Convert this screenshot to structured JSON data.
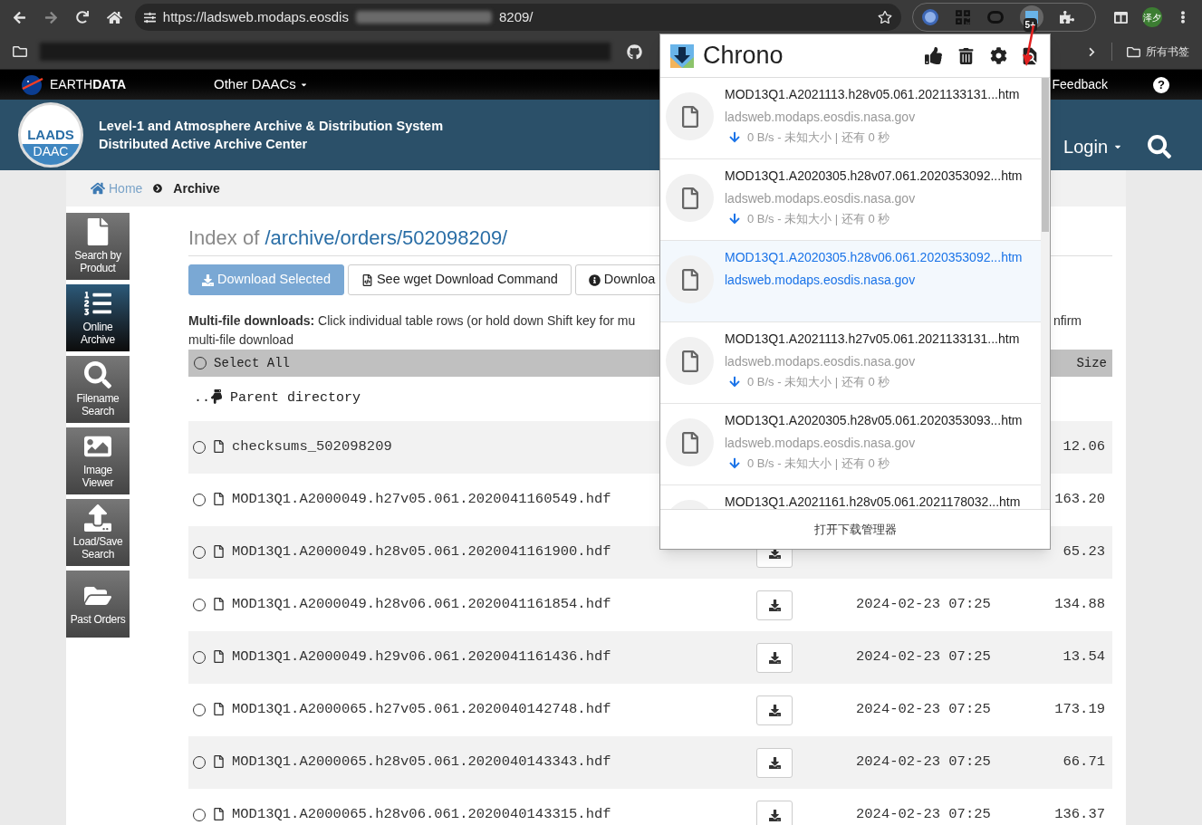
{
  "browser": {
    "url_start": "https://ladsweb.modaps.eosdis",
    "url_end": "8209/",
    "extension_badge": "5+",
    "avatar": "泽夕",
    "all_bookmarks": "所有书签"
  },
  "earthdata_bar": {
    "brand": "EARTH**DATA**",
    "menu": "Other DAACs",
    "feedback": "Feedback",
    "help": "?"
  },
  "site_header": {
    "logo_top": "LAADS",
    "logo_bottom": "DAAC",
    "title_lines": [
      "Level-1 and Atmosphere Archive & Distribution System",
      "Distributed Active Archive Center"
    ],
    "login": "Login"
  },
  "breadcrumb": [
    {
      "label": "Home",
      "kind": "link"
    },
    {
      "label": "Archive",
      "kind": "current"
    }
  ],
  "sidebar": [
    {
      "lines": [
        "Search by",
        "Product"
      ],
      "selected": false
    },
    {
      "lines": [
        "Online",
        "Archive"
      ],
      "selected": true
    },
    {
      "lines": [
        "Filename",
        "Search"
      ],
      "selected": false
    },
    {
      "lines": [
        "Image",
        "Viewer"
      ],
      "selected": false
    },
    {
      "lines": [
        "Load/Save",
        "Search"
      ],
      "selected": false
    },
    {
      "lines": [
        "Past Orders"
      ],
      "selected": false
    }
  ],
  "index": {
    "prefix": "Index of ",
    "path": "/archive/orders/502098209/"
  },
  "buttons": [
    {
      "label": "Download Selected",
      "kind": "primary"
    },
    {
      "label": "See wget Download Command",
      "kind": "wget"
    },
    {
      "label": "Downloa",
      "kind": "info"
    }
  ],
  "note": {
    "lead": "Multi-file downloads:",
    "text": "Click individual table rows (or hold down Shift key for mu",
    "tail": "nfirm",
    "line2": "multi-file download"
  },
  "table": {
    "select_all": "Select All",
    "selected": false,
    "size_header": "Size",
    "parent_dots": "..",
    "parent_label": "Parent directory",
    "rows": [
      {
        "name": "checksums_502098209",
        "size": "12.06",
        "selected": false,
        "download": false
      },
      {
        "name": "MOD13Q1.A2000049.h27v05.061.2020041160549.hdf",
        "size": "163.20",
        "selected": false,
        "download": false
      },
      {
        "name": "MOD13Q1.A2000049.h28v05.061.2020041161900.hdf",
        "size": "65.23",
        "selected": false,
        "download": true
      },
      {
        "name": "MOD13Q1.A2000049.h28v06.061.2020041161854.hdf",
        "date": "2024-02-23 07:25",
        "size": "134.88",
        "selected": false,
        "download": true
      },
      {
        "name": "MOD13Q1.A2000049.h29v06.061.2020041161436.hdf",
        "date": "2024-02-23 07:25",
        "size": "13.54",
        "selected": false,
        "download": true
      },
      {
        "name": "MOD13Q1.A2000065.h27v05.061.2020040142748.hdf",
        "date": "2024-02-23 07:25",
        "size": "173.19",
        "selected": false,
        "download": true
      },
      {
        "name": "MOD13Q1.A2000065.h28v05.061.2020040143343.hdf",
        "date": "2024-02-23 07:25",
        "size": "66.71",
        "selected": false,
        "download": true
      },
      {
        "name": "MOD13Q1.A2000065.h28v06.061.2020040143315.hdf",
        "date": "2024-02-23 07:25",
        "size": "136.37",
        "selected": false,
        "download": true
      }
    ]
  },
  "popup": {
    "title": "Chrono",
    "footer": "打开下载管理器",
    "items": [
      {
        "name": "MOD13Q1.A2021113.h28v05.061.2021133131...htm",
        "host": "ladsweb.modaps.eosdis.nasa.gov",
        "status": "0 B/s - 未知大小 | 还有 0 秒",
        "selected": false
      },
      {
        "name": "MOD13Q1.A2020305.h28v07.061.2020353092...htm",
        "host": "ladsweb.modaps.eosdis.nasa.gov",
        "status": "0 B/s - 未知大小 | 还有 0 秒",
        "selected": false
      },
      {
        "name": "MOD13Q1.A2020305.h28v06.061.2020353092...htm",
        "host": "ladsweb.modaps.eosdis.nasa.gov",
        "selected": true
      },
      {
        "name": "MOD13Q1.A2021113.h27v05.061.2021133131...htm",
        "host": "ladsweb.modaps.eosdis.nasa.gov",
        "status": "0 B/s - 未知大小 | 还有 0 秒",
        "selected": false
      },
      {
        "name": "MOD13Q1.A2020305.h28v05.061.2020353093...htm",
        "host": "ladsweb.modaps.eosdis.nasa.gov",
        "status": "0 B/s - 未知大小 | 还有 0 秒",
        "selected": false
      },
      {
        "name": "MOD13Q1.A2021161.h28v05.061.2021178032...htm",
        "selected": false
      }
    ]
  }
}
